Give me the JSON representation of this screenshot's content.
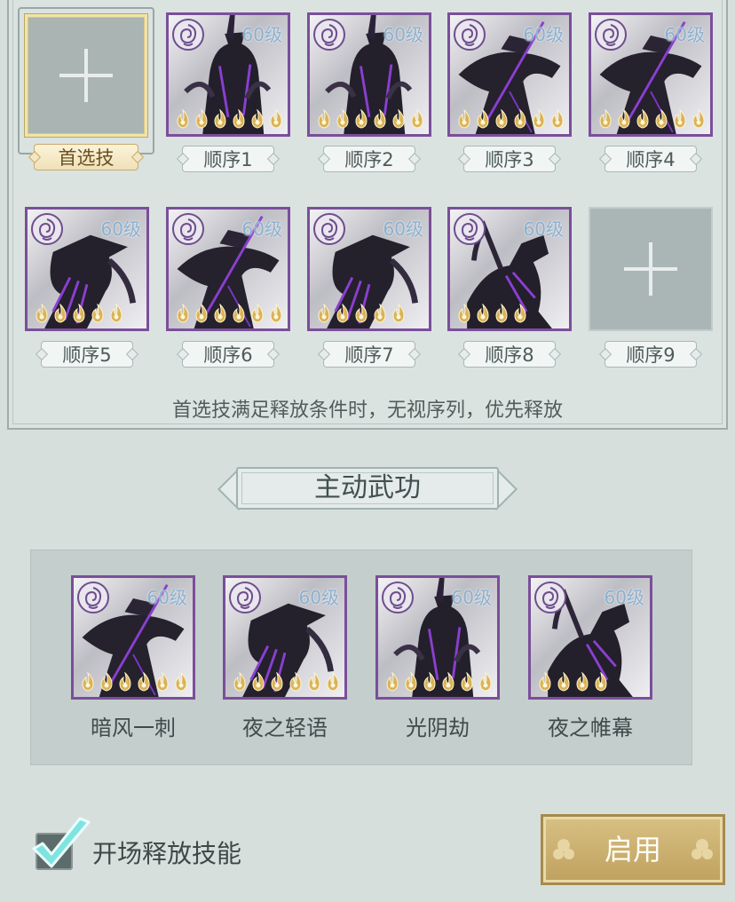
{
  "sequence": {
    "preferred_label": "首选技",
    "slots": [
      {
        "tag": "顺序1",
        "level": "60级",
        "flames": 6,
        "art": "a"
      },
      {
        "tag": "顺序2",
        "level": "60级",
        "flames": 6,
        "art": "a"
      },
      {
        "tag": "顺序3",
        "level": "60级",
        "flames": 6,
        "art": "b"
      },
      {
        "tag": "顺序4",
        "level": "60级",
        "flames": 6,
        "art": "b"
      },
      {
        "tag": "顺序5",
        "level": "60级",
        "flames": 5,
        "art": "c"
      },
      {
        "tag": "顺序6",
        "level": "60级",
        "flames": 6,
        "art": "b"
      },
      {
        "tag": "顺序7",
        "level": "60级",
        "flames": 5,
        "art": "c"
      },
      {
        "tag": "顺序8",
        "level": "60级",
        "flames": 4,
        "art": "d"
      },
      {
        "tag": "顺序9",
        "empty": true
      }
    ],
    "hint": "首选技满足释放条件时，无视序列，优先释放"
  },
  "active_section": {
    "title": "主动武功",
    "skills": [
      {
        "name": "暗风一刺",
        "level": "60级",
        "flames": 6,
        "art": "b"
      },
      {
        "name": "夜之轻语",
        "level": "60级",
        "flames": 6,
        "art": "c"
      },
      {
        "name": "光阴劫",
        "level": "60级",
        "flames": 6,
        "art": "a"
      },
      {
        "name": "夜之帷幕",
        "level": "60级",
        "flames": 4,
        "art": "d"
      }
    ]
  },
  "footer": {
    "open_skill_label": "开场释放技能",
    "open_skill_checked": true,
    "enable_label": "启用"
  },
  "colors": {
    "frame": "#7a4f9a",
    "flame": "#d9b35a",
    "level_text": "#8ab0cf",
    "enable_button": "#c9ad6e"
  }
}
